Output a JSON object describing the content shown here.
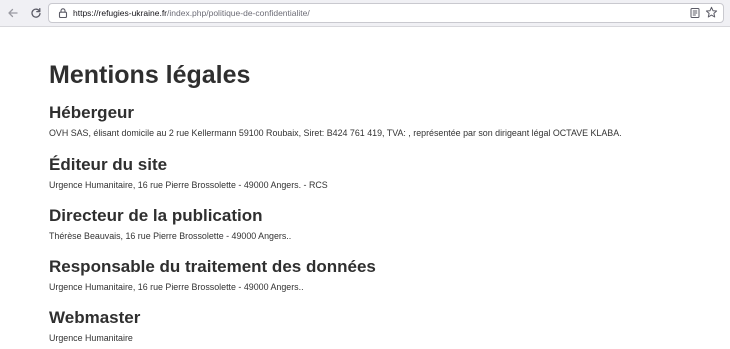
{
  "browser": {
    "url_domain": "https://refugies-ukraine.fr",
    "url_path": "/index.php/politique-de-confidentialite/"
  },
  "page": {
    "title": "Mentions légales",
    "sections": [
      {
        "heading": "Hébergeur",
        "text": "OVH SAS, élisant domicile au 2 rue Kellermann 59100 Roubaix, Siret: B424 761 419, TVA: , représentée par son dirigeant légal OCTAVE KLABA."
      },
      {
        "heading": "Éditeur du site",
        "text": "Urgence Humanitaire, 16 rue Pierre Brossolette - 49000 Angers. - RCS"
      },
      {
        "heading": "Directeur de la publication",
        "text": "Thérèse Beauvais, 16 rue Pierre Brossolette - 49000 Angers.."
      },
      {
        "heading": "Responsable du traitement des données",
        "text": "Urgence Humanitaire, 16 rue Pierre Brossolette - 49000 Angers.."
      },
      {
        "heading": "Webmaster",
        "text": "Urgence Humanitaire"
      }
    ]
  },
  "icons": {
    "back": "arrow-left-icon",
    "reload": "reload-icon",
    "lock": "lock-icon",
    "reader": "reader-view-icon",
    "bookmark": "star-icon"
  }
}
